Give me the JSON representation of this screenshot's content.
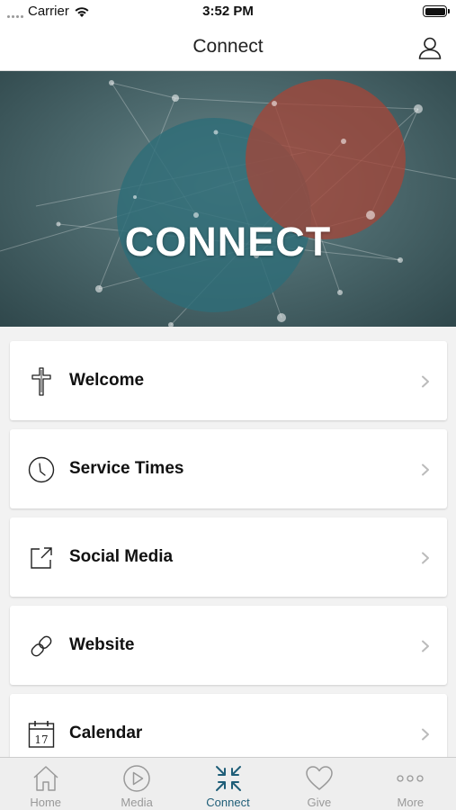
{
  "status_bar": {
    "carrier": "Carrier",
    "time": "3:52 PM"
  },
  "nav": {
    "title": "Connect",
    "profile_icon": "person-icon"
  },
  "hero": {
    "title": "CONNECT"
  },
  "menu": [
    {
      "label": "Welcome",
      "icon": "cross-icon"
    },
    {
      "label": "Service Times",
      "icon": "clock-icon"
    },
    {
      "label": "Social Media",
      "icon": "external-link-icon"
    },
    {
      "label": "Website",
      "icon": "link-icon"
    },
    {
      "label": "Calendar",
      "icon": "calendar-icon",
      "calendar_day": "17"
    }
  ],
  "tabs": [
    {
      "label": "Home",
      "icon": "home-icon",
      "active": false
    },
    {
      "label": "Media",
      "icon": "play-icon",
      "active": false
    },
    {
      "label": "Connect",
      "icon": "compress-arrows-icon",
      "active": true
    },
    {
      "label": "Give",
      "icon": "heart-icon",
      "active": false
    },
    {
      "label": "More",
      "icon": "more-dots-icon",
      "active": false
    }
  ],
  "colors": {
    "accent": "#1f5e78",
    "tab_inactive": "#999999",
    "hero_circle_teal": "#2e6d78",
    "hero_circle_red": "#a1473a"
  }
}
